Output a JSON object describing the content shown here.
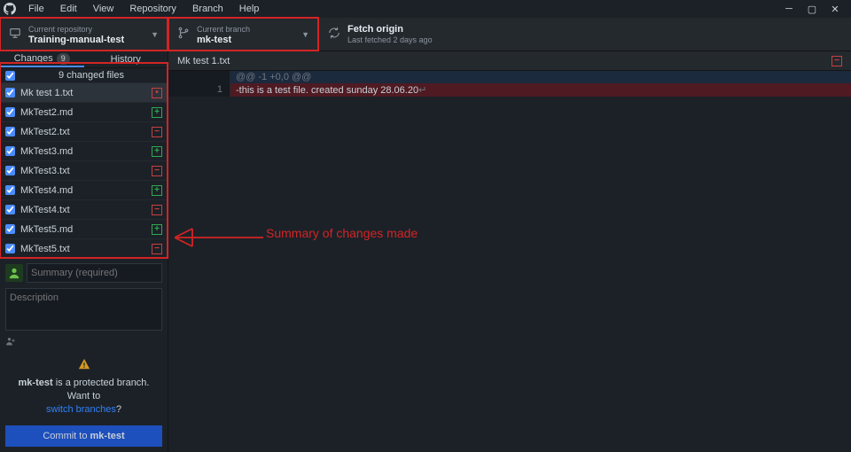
{
  "menu": {
    "items": [
      "File",
      "Edit",
      "View",
      "Repository",
      "Branch",
      "Help"
    ]
  },
  "header": {
    "repo": {
      "top": "Current repository",
      "bot": "Training-manual-test"
    },
    "branch": {
      "top": "Current branch",
      "bot": "mk-test"
    },
    "fetch": {
      "top": "Fetch origin",
      "bot": "Last fetched 2 days ago"
    }
  },
  "sidebar": {
    "tabs": {
      "changes": "Changes",
      "changes_count": "9",
      "history": "History"
    },
    "all_label": "9 changed files",
    "files": [
      {
        "name": "Mk test 1.txt",
        "status": "mod",
        "selected": true
      },
      {
        "name": "MkTest2.md",
        "status": "add"
      },
      {
        "name": "MkTest2.txt",
        "status": "rm"
      },
      {
        "name": "MkTest3.md",
        "status": "add"
      },
      {
        "name": "MkTest3.txt",
        "status": "rm"
      },
      {
        "name": "MkTest4.md",
        "status": "add"
      },
      {
        "name": "MkTest4.txt",
        "status": "rm"
      },
      {
        "name": "MkTest5.md",
        "status": "add"
      },
      {
        "name": "MkTest5.txt",
        "status": "rm"
      }
    ]
  },
  "commit": {
    "summary_ph": "Summary (required)",
    "desc_ph": "Description",
    "coauthor_icon": "coauthor",
    "warn_pre": "mk-test",
    "warn_mid": " is a protected branch. Want to ",
    "warn_link": "switch branches",
    "warn_q": "?",
    "btn_pre": "Commit to ",
    "btn_branch": "mk-test"
  },
  "maintab": {
    "label": "Mk test 1.txt"
  },
  "diff": {
    "hunk": "@@ -1 +0,0 @@",
    "line_num": "1",
    "removed": "-this is a test file. created sunday 28.06.20",
    "tail": "↵"
  },
  "annotation": "Summary of changes made"
}
